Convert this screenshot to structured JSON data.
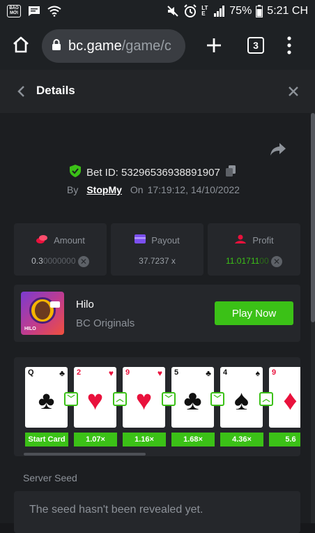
{
  "status_bar": {
    "left_badge": "BÁO MỚI",
    "battery": "75%",
    "time": "5:21 CH",
    "network": "LTE"
  },
  "browser": {
    "url_domain": "bc.game",
    "url_path": "/game/c",
    "tab_count": "3"
  },
  "header": {
    "title": "Details"
  },
  "bet": {
    "id_label": "Bet ID: 53296536938891907",
    "by_label": "By",
    "user": "StopMy",
    "on_label": "On",
    "datetime": "17:19:12, 14/10/2022"
  },
  "stats": [
    {
      "label": "Amount",
      "value_main": "0.3",
      "value_dim": "0000000",
      "icon": "coins-icon",
      "color": "#e9113c"
    },
    {
      "label": "Payout",
      "value_main": "37.7237 x",
      "value_dim": "",
      "icon": "wallet-icon",
      "color": "#7b4ff0"
    },
    {
      "label": "Profit",
      "value_main": "11.01711",
      "value_dim": "00",
      "icon": "profit-icon",
      "color": "#e9113c"
    }
  ],
  "game": {
    "name": "Hilo",
    "provider": "BC Originals",
    "thumb_label": "HILO",
    "play_label": "Play Now"
  },
  "cards": [
    {
      "rank": "Q",
      "suit": "♣",
      "color": "blk",
      "mult": "Start Card",
      "arrow": ""
    },
    {
      "rank": "2",
      "suit": "♥",
      "color": "red",
      "mult": "1.07×",
      "arrow": "down"
    },
    {
      "rank": "9",
      "suit": "♥",
      "color": "red",
      "mult": "1.16×",
      "arrow": "up"
    },
    {
      "rank": "5",
      "suit": "♣",
      "color": "blk",
      "mult": "1.68×",
      "arrow": "down"
    },
    {
      "rank": "4",
      "suit": "♠",
      "color": "blk",
      "mult": "4.36×",
      "arrow": "down"
    },
    {
      "rank": "9",
      "suit": "♦",
      "color": "red",
      "mult": "5.6",
      "arrow": "up"
    }
  ],
  "server_seed": {
    "label": "Server Seed",
    "placeholder": "The seed hasn't been revealed yet."
  },
  "colors": {
    "accent_green": "#3bc117",
    "bg": "#1c1e21",
    "panel": "#25272b"
  }
}
